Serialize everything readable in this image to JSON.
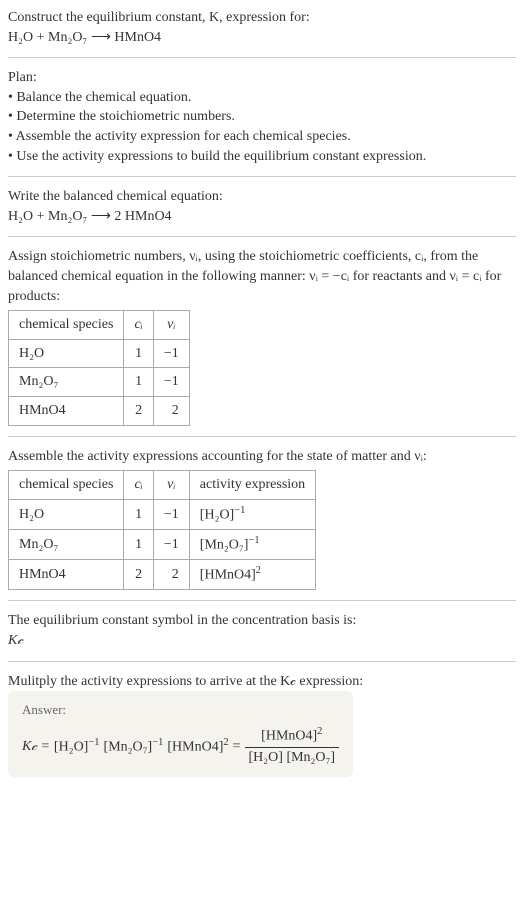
{
  "title_line1": "Construct the equilibrium constant, K, expression for:",
  "title_line2": "H₂O + Mn₂O₇ ⟶ HMnO4",
  "plan_header": "Plan:",
  "plan_items": [
    "• Balance the chemical equation.",
    "• Determine the stoichiometric numbers.",
    "• Assemble the activity expression for each chemical species.",
    "• Use the activity expressions to build the equilibrium constant expression."
  ],
  "balanced_intro": "Write the balanced chemical equation:",
  "balanced_eq": "H₂O + Mn₂O₇ ⟶ 2 HMnO4",
  "stoich_intro": "Assign stoichiometric numbers, νᵢ, using the stoichiometric coefficients, cᵢ, from the balanced chemical equation in the following manner: νᵢ = −cᵢ for reactants and νᵢ = cᵢ for products:",
  "table1_headers": {
    "c0": "chemical species",
    "c1": "cᵢ",
    "c2": "νᵢ"
  },
  "table1_rows": [
    {
      "species": "H₂O",
      "ci": "1",
      "vi": "−1"
    },
    {
      "species": "Mn₂O₇",
      "ci": "1",
      "vi": "−1"
    },
    {
      "species": "HMnO4",
      "ci": "2",
      "vi": "2"
    }
  ],
  "activity_intro": "Assemble the activity expressions accounting for the state of matter and νᵢ:",
  "table2_headers": {
    "c0": "chemical species",
    "c1": "cᵢ",
    "c2": "νᵢ",
    "c3": "activity expression"
  },
  "table2_rows": [
    {
      "species": "H₂O",
      "ci": "1",
      "vi": "−1",
      "act_base": "[H₂O]",
      "act_exp": "−1"
    },
    {
      "species": "Mn₂O₇",
      "ci": "1",
      "vi": "−1",
      "act_base": "[Mn₂O₇]",
      "act_exp": "−1"
    },
    {
      "species": "HMnO4",
      "ci": "2",
      "vi": "2",
      "act_base": "[HMnO4]",
      "act_exp": "2"
    }
  ],
  "kc_symbol_intro": "The equilibrium constant symbol in the concentration basis is:",
  "kc_symbol": "K𝒸",
  "multiply_intro": "Mulitply the activity expressions to arrive at the K𝒸 expression:",
  "answer_label": "Answer:",
  "final_lhs": "K𝒸 = ",
  "final_terms": {
    "t1_base": "[H₂O]",
    "t1_exp": "−1",
    "t2_base": "[Mn₂O₇]",
    "t2_exp": "−1",
    "t3_base": "[HMnO4]",
    "t3_exp": "2"
  },
  "final_frac": {
    "num_base": "[HMnO4]",
    "num_exp": "2",
    "den": "[H₂O] [Mn₂O₇]"
  },
  "chart_data": {
    "type": "table",
    "tables": [
      {
        "title": "Stoichiometric numbers",
        "columns": [
          "chemical species",
          "c_i",
          "v_i"
        ],
        "rows": [
          [
            "H2O",
            1,
            -1
          ],
          [
            "Mn2O7",
            1,
            -1
          ],
          [
            "HMnO4",
            2,
            2
          ]
        ]
      },
      {
        "title": "Activity expressions",
        "columns": [
          "chemical species",
          "c_i",
          "v_i",
          "activity expression"
        ],
        "rows": [
          [
            "H2O",
            1,
            -1,
            "[H2O]^-1"
          ],
          [
            "Mn2O7",
            1,
            -1,
            "[Mn2O7]^-1"
          ],
          [
            "HMnO4",
            2,
            2,
            "[HMnO4]^2"
          ]
        ]
      }
    ]
  }
}
